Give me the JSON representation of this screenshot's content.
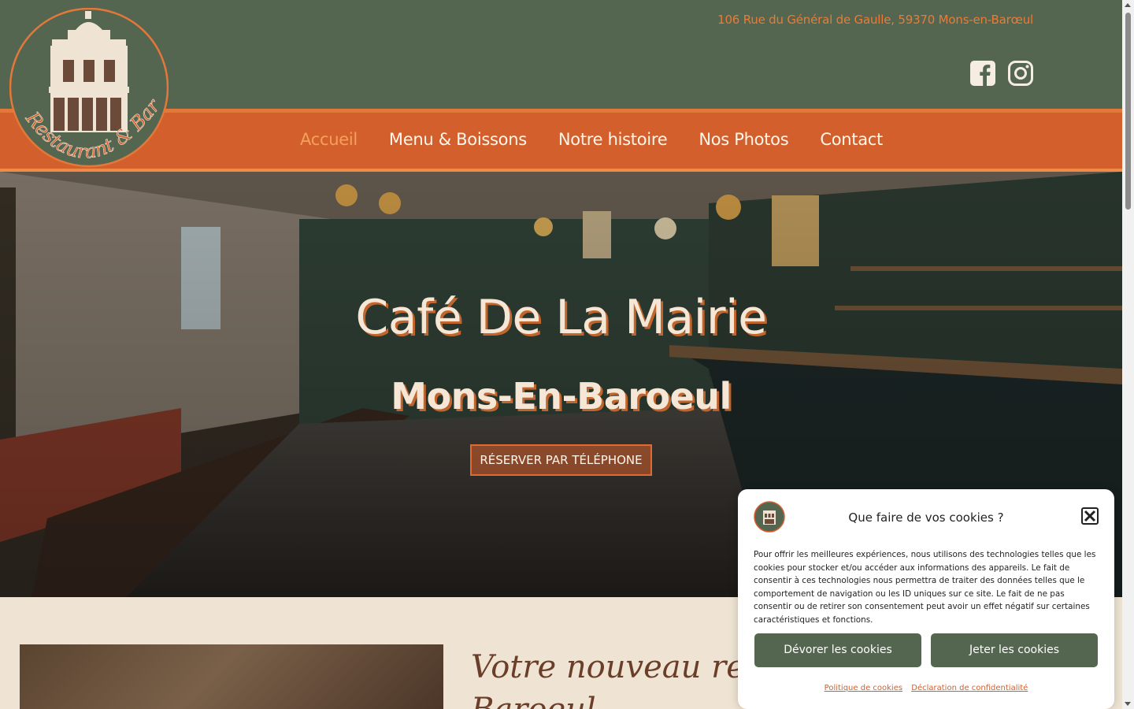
{
  "header": {
    "address": "106 Rue du Général de Gaulle, 59370 Mons-en-Barœul",
    "logo_text": "Restaurant & Bar",
    "social": [
      {
        "icon": "facebook-icon"
      },
      {
        "icon": "instagram-icon"
      }
    ]
  },
  "nav": {
    "items": [
      {
        "label": "Accueil",
        "active": true
      },
      {
        "label": "Menu & Boissons",
        "active": false
      },
      {
        "label": "Notre histoire",
        "active": false
      },
      {
        "label": "Nos Photos",
        "active": false
      },
      {
        "label": "Contact",
        "active": false
      }
    ]
  },
  "hero": {
    "title": "Café De La Mairie",
    "subtitle": "Mons-En-Baroeul",
    "cta": "RÉSERVER PAR TÉLÉPHONE"
  },
  "intro": {
    "heading_line1": "Votre nouveau restaurant",
    "heading_line2": "Baroeul"
  },
  "cookie": {
    "title": "Que faire de vos cookies ?",
    "text": "Pour offrir les meilleures expériences, nous utilisons des technologies telles que les cookies pour stocker et/ou accéder aux informations des appareils. Le fait de consentir à ces technologies nous permettra de traiter des données telles que le comportement de navigation ou les ID uniques sur ce site. Le fait de ne pas consentir ou de retirer son consentement peut avoir un effet négatif sur certaines caractéristiques et fonctions.",
    "accept": "Dévorer les cookies",
    "deny": "Jeter les cookies",
    "link_policy": "Politique de cookies",
    "link_privacy": "Déclaration de confidentialité"
  },
  "colors": {
    "green": "#556650",
    "orange": "#d35f2c",
    "cream": "#efe4d3",
    "accent": "#e87c36"
  }
}
